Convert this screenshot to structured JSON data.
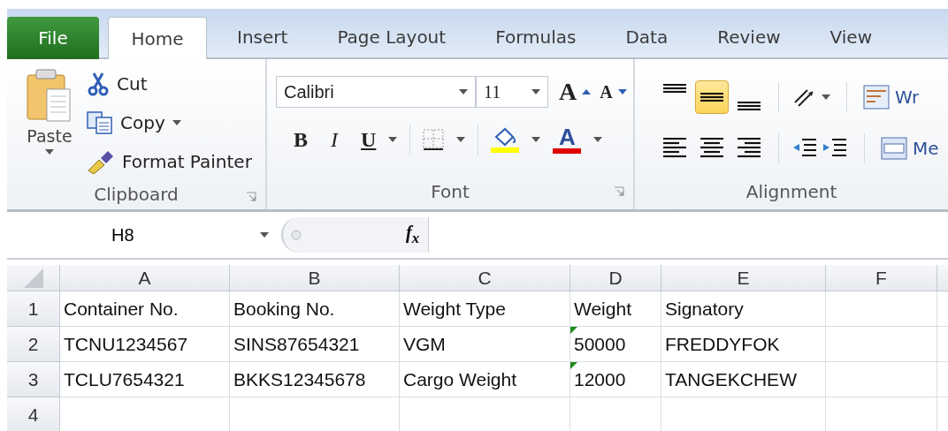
{
  "tabs": [
    {
      "label": "File",
      "kind": "file",
      "selected": false
    },
    {
      "label": "Home",
      "kind": "tab",
      "selected": true
    },
    {
      "label": "Insert",
      "kind": "tab",
      "selected": false
    },
    {
      "label": "Page Layout",
      "kind": "tab",
      "selected": false
    },
    {
      "label": "Formulas",
      "kind": "tab",
      "selected": false
    },
    {
      "label": "Data",
      "kind": "tab",
      "selected": false
    },
    {
      "label": "Review",
      "kind": "tab",
      "selected": false
    },
    {
      "label": "View",
      "kind": "tab",
      "selected": false
    }
  ],
  "clipboard": {
    "label": "Clipboard",
    "paste": "Paste",
    "items": [
      {
        "kind": "cut",
        "label": "Cut"
      },
      {
        "kind": "copy",
        "label": "Copy"
      },
      {
        "kind": "painter",
        "label": "Format Painter"
      }
    ]
  },
  "font": {
    "label": "Font",
    "font_name": "Calibri",
    "font_size": "11",
    "grow": "A",
    "shrink": "A",
    "bold": "B",
    "italic": "I",
    "underline": "U",
    "font_color": "A"
  },
  "alignment": {
    "label": "Alignment",
    "buttons": [
      {
        "kind": "top",
        "selected": false
      },
      {
        "kind": "middle",
        "selected": true
      },
      {
        "kind": "bottom",
        "selected": false
      },
      {
        "kind": "left",
        "selected": false
      },
      {
        "kind": "center",
        "selected": false
      },
      {
        "kind": "right",
        "selected": false
      }
    ],
    "wrap": "Wr",
    "merge": "Me"
  },
  "formula_bar": {
    "name_box": "H8",
    "fx": "f$_{x}$"
  },
  "sheet": {
    "columns": [
      "A",
      "B",
      "C",
      "D",
      "E",
      "F"
    ],
    "rows": [
      {
        "header": "1",
        "cells": [
          {
            "text": "Container No.",
            "warning": false
          },
          {
            "text": "Booking No.",
            "warning": false
          },
          {
            "text": "Weight Type",
            "warning": false
          },
          {
            "text": "Weight",
            "warning": false
          },
          {
            "text": "Signatory",
            "warning": false
          }
        ]
      },
      {
        "header": "2",
        "cells": [
          {
            "text": "TCNU1234567",
            "warning": false
          },
          {
            "text": "SINS87654321",
            "warning": false
          },
          {
            "text": "VGM",
            "warning": false
          },
          {
            "text": "50000",
            "warning": true
          },
          {
            "text": "FREDDYFOK",
            "warning": false
          }
        ]
      },
      {
        "header": "3",
        "cells": [
          {
            "text": "TCLU7654321",
            "warning": false
          },
          {
            "text": "BKKS12345678",
            "warning": false
          },
          {
            "text": "Cargo Weight",
            "warning": false
          },
          {
            "text": "12000",
            "warning": true
          },
          {
            "text": "TANGEKCHEW",
            "warning": false
          }
        ]
      },
      {
        "header": "4"
      }
    ]
  }
}
